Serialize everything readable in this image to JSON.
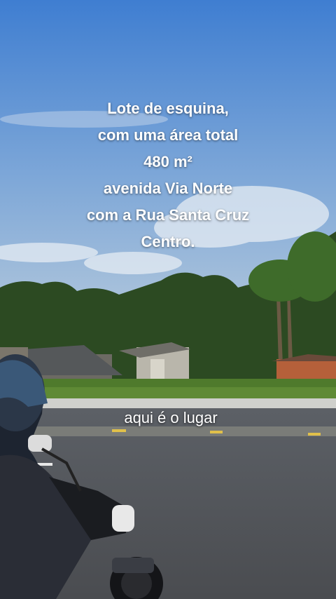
{
  "overlay": {
    "lines": [
      "Lote de esquina,",
      "com uma área total",
      "480 m²",
      "avenida Via Norte",
      "com a Rua Santa Cruz",
      "Centro."
    ],
    "subtitle": "aqui é o lugar"
  },
  "colors": {
    "sky_top": "#3f7ed1",
    "sky_bottom": "#a9c3dc",
    "road": "#5b5e62",
    "grass": "#4f7a2c",
    "brick": "#b5603a"
  }
}
